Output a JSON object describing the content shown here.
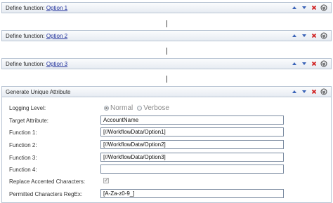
{
  "define_panels": [
    {
      "prefix": "Define function:",
      "link": "Option 1"
    },
    {
      "prefix": "Define function:",
      "link": "Option 2"
    },
    {
      "prefix": "Define function:",
      "link": "Option 3"
    }
  ],
  "unique_panel": {
    "title": "Generate Unique Attribute",
    "logging_label": "Logging Level:",
    "logging_options": [
      "Normal",
      "Verbose"
    ],
    "logging_selected": "Normal",
    "target_label": "Target Attribute:",
    "target_value": "AccountName",
    "function1_label": "Function 1:",
    "function1_value": "[//WorkflowData/Option1]",
    "function2_label": "Function 2:",
    "function2_value": "[//WorkflowData/Option2]",
    "function3_label": "Function 3:",
    "function3_value": "[//WorkflowData/Option3]",
    "function4_label": "Function 4:",
    "function4_value": "",
    "replace_label": "Replace Accented Characters:",
    "replace_checked": true,
    "regex_label": "Permitted Characters RegEx:",
    "regex_value": "[A-Za-z0-9_]"
  },
  "controls": {
    "icons": [
      "move-up-icon",
      "move-down-icon",
      "delete-icon",
      "collapse-icon"
    ],
    "colors": {
      "up": "#3a63b8",
      "delete": "#d02020",
      "collapse": "#444444"
    }
  }
}
